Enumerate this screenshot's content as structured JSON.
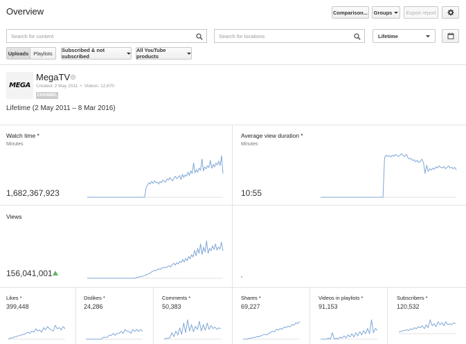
{
  "header": {
    "title": "Overview",
    "comparison_label": "Comparison...",
    "groups_label": "Groups",
    "export_label": "Export report"
  },
  "filters": {
    "content_search_placeholder": "Search for content",
    "location_search_placeholder": "Search for locations",
    "date_range": "Lifetime",
    "tab_uploads": "Uploads",
    "tab_playlists": "Playlists",
    "subscribed_filter": "Subscribed & not subscribed",
    "products_filter": "All YouTube products"
  },
  "channel": {
    "logo_text": "MEGA",
    "name": "MegaTV",
    "meta": "Created: 2 May 2011  •  Videos: 12,670",
    "badge": "CHANNEL",
    "range": "Lifetime (2 May 2011 – 8 Mar 2016)"
  },
  "metrics": {
    "watch_time": {
      "title": "Watch time *",
      "unit": "Minutes",
      "value": "1,682,367,923"
    },
    "avg_view_duration": {
      "title": "Average view duration *",
      "unit": "Minutes",
      "value": "10:55"
    },
    "views": {
      "title": "Views",
      "value": "156,041,001",
      "trend_icon": "up-arrow-icon"
    }
  },
  "small_metrics": [
    {
      "title": "Likes *",
      "value": "399,448"
    },
    {
      "title": "Dislikes *",
      "value": "24,286"
    },
    {
      "title": "Comments *",
      "value": "50,383"
    },
    {
      "title": "Shares *",
      "value": "69,227"
    },
    {
      "title": "Videos in playlists *",
      "value": "91,153"
    },
    {
      "title": "Subscribers *",
      "value": "120,532"
    }
  ],
  "colors": {
    "sparkline": "#7ea6d6",
    "trend_up": "#5fb25f",
    "badge_bg": "#cccccc"
  },
  "sparklines": {
    "watch_time": [
      0,
      0,
      0,
      0,
      0,
      0,
      0,
      0,
      0,
      0,
      0,
      0,
      0,
      0,
      0,
      0,
      0,
      0,
      0,
      0,
      0,
      0,
      0,
      0,
      0,
      0,
      0,
      0,
      0,
      0,
      0,
      0,
      0,
      0,
      0,
      0,
      0,
      0,
      0,
      0,
      0,
      0,
      14,
      18,
      22,
      20,
      24,
      21,
      25,
      22,
      23,
      20,
      24,
      22,
      26,
      24,
      23,
      28,
      26,
      30,
      27,
      25,
      29,
      32,
      28,
      30,
      33,
      27,
      35,
      30,
      34,
      32,
      38,
      33,
      40,
      36,
      52,
      37,
      42,
      38,
      44,
      41,
      58,
      40,
      46,
      43,
      48,
      45,
      56,
      44,
      50,
      46,
      52,
      49,
      55,
      48,
      63,
      36
    ],
    "avg_view_duration": [
      0,
      0,
      0,
      0,
      0,
      0,
      0,
      0,
      0,
      0,
      0,
      0,
      0,
      0,
      0,
      0,
      0,
      0,
      0,
      0,
      0,
      0,
      0,
      0,
      0,
      0,
      0,
      0,
      0,
      0,
      0,
      0,
      0,
      0,
      0,
      0,
      0,
      0,
      0,
      0,
      0,
      58,
      62,
      60,
      61,
      59,
      62,
      60,
      63,
      61,
      60,
      62,
      64,
      61,
      60,
      63,
      58,
      56,
      57,
      54,
      55,
      52,
      54,
      51,
      53,
      56,
      50,
      35,
      47,
      38,
      42,
      40,
      43,
      41,
      45,
      43,
      46,
      44,
      43,
      45,
      42,
      44,
      46,
      43,
      44,
      42,
      44,
      40
    ],
    "views": [
      0,
      0,
      0,
      0,
      0,
      0,
      0,
      0,
      0,
      0,
      0,
      0,
      0,
      0,
      0,
      0,
      0,
      0,
      0,
      0,
      0,
      0,
      0,
      0,
      0,
      0,
      0,
      0,
      0,
      0,
      0,
      0,
      0,
      1,
      2,
      2,
      3,
      3,
      4,
      5,
      6,
      7,
      8,
      10,
      11,
      13,
      12,
      14,
      15,
      14,
      17,
      16,
      18,
      17,
      19,
      20,
      18,
      22,
      24,
      21,
      25,
      23,
      27,
      25,
      30,
      26,
      32,
      28,
      35,
      31,
      38,
      34,
      45,
      36,
      48,
      40,
      55,
      38,
      50,
      42,
      60,
      40,
      48,
      44,
      52,
      46,
      55,
      45,
      50,
      47,
      58,
      44
    ],
    "likes": [
      0,
      1,
      1,
      2,
      2,
      3,
      3,
      4,
      4,
      5,
      6,
      5,
      7,
      6,
      9,
      7,
      8,
      6,
      10,
      8,
      11,
      9,
      8,
      7,
      12,
      9,
      10,
      8,
      11,
      9
    ],
    "dislikes": [
      0,
      0,
      0,
      0,
      0,
      0,
      0,
      0,
      0,
      1,
      1,
      1,
      2,
      2,
      3,
      2,
      3,
      3,
      4,
      3,
      5,
      4,
      4,
      3,
      5,
      4,
      5,
      4,
      5,
      4
    ],
    "comments": [
      0,
      1,
      1,
      2,
      8,
      3,
      10,
      5,
      14,
      6,
      20,
      8,
      24,
      10,
      18,
      9,
      16,
      12,
      22,
      10,
      18,
      11,
      20,
      12,
      17,
      13,
      15,
      12,
      14,
      13
    ],
    "shares": [
      0,
      0,
      0,
      1,
      1,
      2,
      2,
      3,
      3,
      4,
      5,
      6,
      5,
      7,
      8,
      10,
      9,
      12,
      11,
      13,
      12,
      15,
      14,
      16,
      15,
      18,
      17,
      20,
      19,
      22
    ],
    "videos_in_playlists": [
      0,
      0,
      0,
      0,
      1,
      0,
      6,
      0,
      1,
      0,
      2,
      1,
      3,
      1,
      4,
      2,
      5,
      2,
      6,
      3,
      7,
      4,
      8,
      5,
      10,
      5,
      18,
      6,
      10,
      8
    ],
    "subscribers": [
      2,
      2,
      3,
      3,
      4,
      3,
      5,
      4,
      6,
      5,
      7,
      6,
      8,
      5,
      9,
      6,
      14,
      8,
      10,
      7,
      12,
      9,
      11,
      8,
      12,
      9,
      10,
      9,
      11,
      10
    ]
  }
}
